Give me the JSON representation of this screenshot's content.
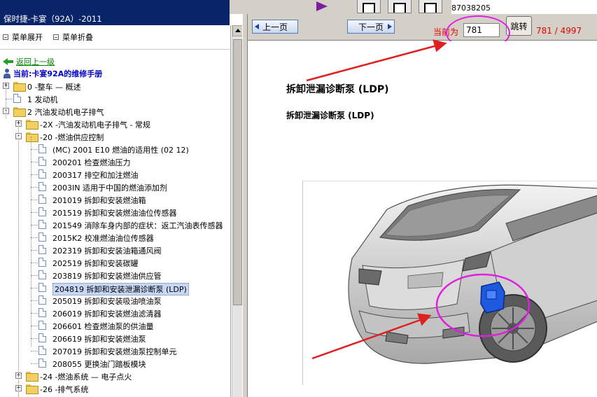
{
  "window": {
    "title": "保时捷-卡宴（92A）-2011"
  },
  "top_info": {
    "line1_prefix": "",
    "line1_red": "",
    "line2": "87038205"
  },
  "left_menu": {
    "expand_label": "菜单展开",
    "collapse_label": "菜单折叠",
    "back_label": "返回上一级",
    "current_label": "当前:卡宴92A的维修手册"
  },
  "tree": [
    {
      "text": "0 -整车 — 概述",
      "kind": "folder",
      "expander": "+"
    },
    {
      "text": "1 发动机",
      "kind": "doc",
      "expander": ""
    },
    {
      "text": "2 汽油发动机电子排气",
      "kind": "folder",
      "expander": "-"
    },
    {
      "text": "-2X -汽油发动机电子排气 - 常规",
      "kind": "folder",
      "expander": "+"
    },
    {
      "text": "-20 -燃油供应控制",
      "kind": "folder",
      "expander": "-"
    },
    {
      "text": "(MC) 2001 E10 燃油的适用性 (02 12)",
      "kind": "doc",
      "expander": ""
    },
    {
      "text": "200201 检查燃油压力",
      "kind": "doc",
      "expander": ""
    },
    {
      "text": "200317 排空和加注燃油",
      "kind": "doc",
      "expander": ""
    },
    {
      "text": "2003IN 适用于中国的燃油添加剂",
      "kind": "doc",
      "expander": ""
    },
    {
      "text": "201019 拆卸和安装燃油箱",
      "kind": "doc",
      "expander": ""
    },
    {
      "text": "201519 拆卸和安装燃油油位传感器",
      "kind": "doc",
      "expander": ""
    },
    {
      "text": "201549 消除车身内部的症状：返工汽油表传感器（",
      "kind": "doc",
      "expander": ""
    },
    {
      "text": "2015K2 校准燃油油位传感器",
      "kind": "doc",
      "expander": ""
    },
    {
      "text": "202319 拆卸和安装油箱通风阀",
      "kind": "doc",
      "expander": ""
    },
    {
      "text": "202519 拆卸和安装碳罐",
      "kind": "doc",
      "expander": ""
    },
    {
      "text": "203819 拆卸和安装燃油供应管",
      "kind": "doc",
      "expander": ""
    },
    {
      "text": "204819 拆卸和安装泄漏诊断泵 (LDP)",
      "kind": "doc",
      "expander": "",
      "selected": true
    },
    {
      "text": "205019 拆卸和安装吸油喷油泵",
      "kind": "doc",
      "expander": ""
    },
    {
      "text": "206019 拆卸和安装燃油滤清器",
      "kind": "doc",
      "expander": ""
    },
    {
      "text": "206601 检查燃油泵的供油量",
      "kind": "doc",
      "expander": ""
    },
    {
      "text": "206619 拆卸和安装燃油泵",
      "kind": "doc",
      "expander": ""
    },
    {
      "text": "207019 拆卸和安装燃油泵控制单元",
      "kind": "doc",
      "expander": ""
    },
    {
      "text": "208055 更换油门踏板模块",
      "kind": "doc",
      "expander": ""
    },
    {
      "text": "-24 -燃油系统 — 电子点火",
      "kind": "folder",
      "expander": "+"
    },
    {
      "text": "-26 -排气系统",
      "kind": "folder",
      "expander": "+"
    }
  ],
  "pager": {
    "prev_label": "上一页",
    "next_label": "下一页",
    "current_prefix": "当前为",
    "current_value": "781",
    "jump_label": "跳转",
    "count": "781 / 4997"
  },
  "document": {
    "heading": "拆卸泄漏诊断泵 (LDP)",
    "subheading": "拆卸泄漏诊断泵 (LDP)"
  },
  "colors": {
    "annotation": "#e020e0",
    "arrow": "#e02020",
    "title_bar": "#0a246a",
    "page_text": "#e00000"
  }
}
